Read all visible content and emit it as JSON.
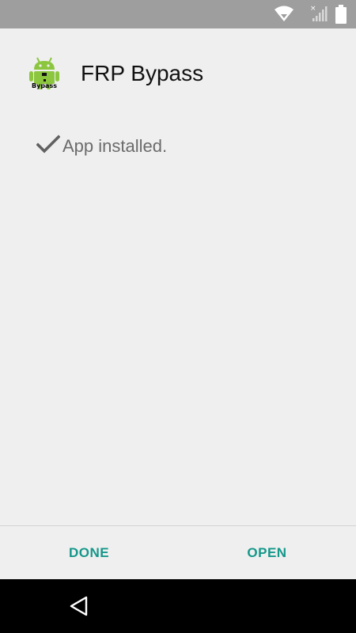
{
  "status_bar": {
    "icons": [
      "wifi-icon",
      "no-signal-icon",
      "battery-icon"
    ],
    "background_color": "#9e9e9e"
  },
  "app": {
    "name": "FRP Bypass",
    "icon": "android-app-icon",
    "icon_caption": "Bypass"
  },
  "install": {
    "status_icon": "check-icon",
    "message": "App installed."
  },
  "actions": {
    "done_label": "DONE",
    "open_label": "OPEN",
    "accent_color": "#15978a"
  },
  "nav_bar": {
    "icons": [
      "back-icon"
    ]
  }
}
